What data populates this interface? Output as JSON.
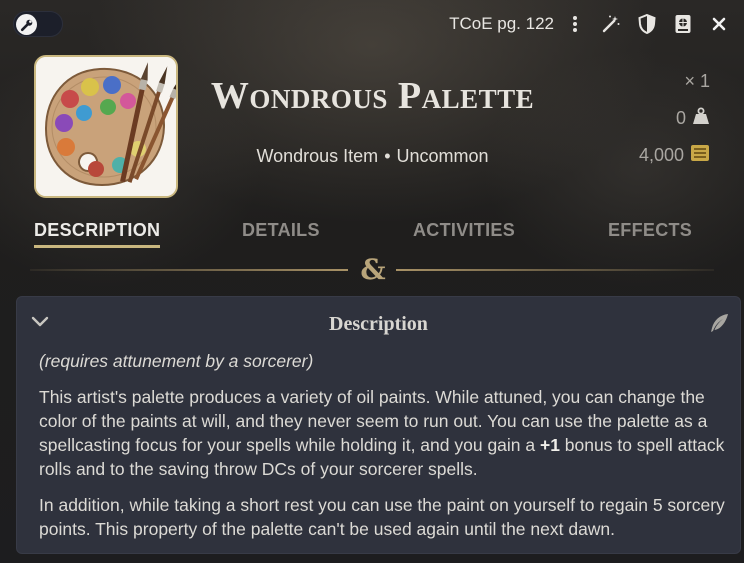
{
  "topbar": {
    "source": "TCoE pg. 122",
    "icons": [
      "wrench-icon",
      "vertical-ellipsis-icon",
      "magic-wand-icon",
      "shield-icon",
      "book-icon",
      "close-icon"
    ]
  },
  "item": {
    "name": "Wondrous Palette",
    "type": "Wondrous Item",
    "separator": "•",
    "rarity": "Uncommon",
    "quantity": "× 1",
    "weight": "0",
    "price": "4,000"
  },
  "tabs": [
    {
      "label": "Description",
      "active": true
    },
    {
      "label": "Details",
      "active": false
    },
    {
      "label": "Activities",
      "active": false
    },
    {
      "label": "Effects",
      "active": false
    }
  ],
  "divider_glyph": "&",
  "description": {
    "heading": "Description",
    "attunement": "(requires attunement by a sorcerer)",
    "para1_a": "This artist's palette produces a variety of oil paints. While attuned, you can change the color of the paints at will, and they never seem to run out. You can use the palette as a spellcasting focus for your spells while holding it, and you gain a ",
    "para1_bonus": "+1",
    "para1_b": " bonus to spell attack rolls and to the saving throw DCs of your sorcerer spells.",
    "para2": "In addition, while taking a short rest you can use the paint on yourself to regain 5 sorcery points. This property of the palette can't be used again until the next dawn."
  },
  "colors": {
    "accent_gold": "#c9b77f",
    "card_bg": "#2f323d"
  }
}
